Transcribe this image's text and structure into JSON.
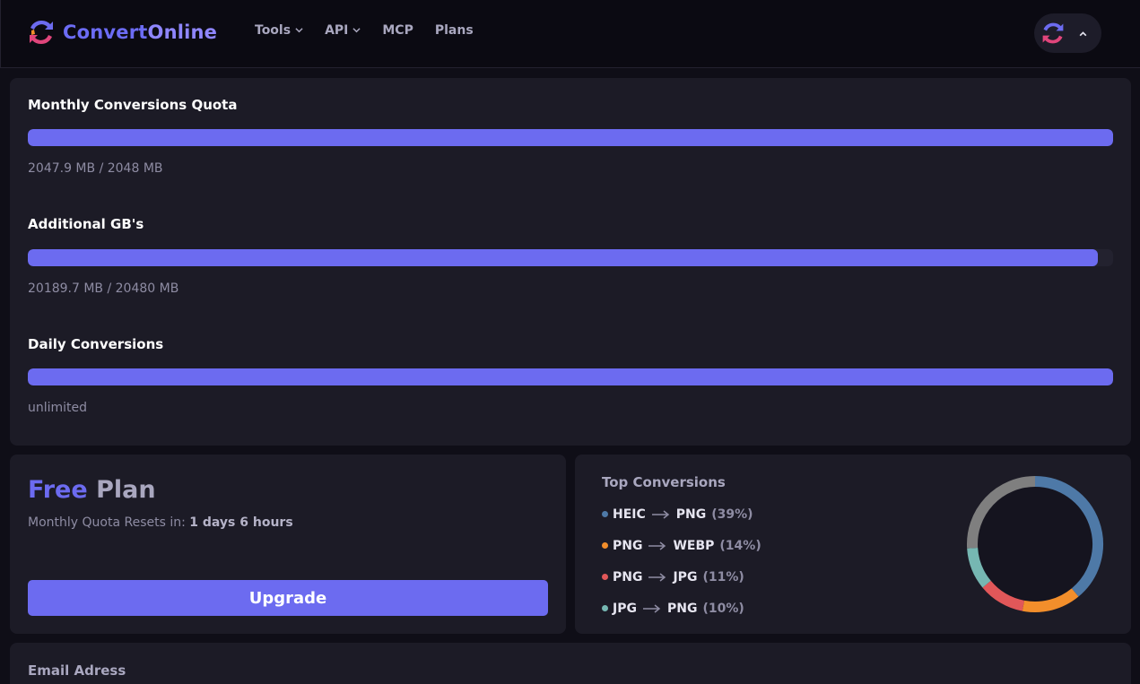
{
  "header": {
    "logo_part1": "Convert",
    "logo_part2": "Online",
    "nav": [
      {
        "label": "Tools",
        "has_dropdown": true
      },
      {
        "label": "API",
        "has_dropdown": true
      },
      {
        "label": "MCP",
        "has_dropdown": false
      },
      {
        "label": "Plans",
        "has_dropdown": false
      }
    ],
    "user_menu_icon": "chevron-up-icon"
  },
  "quota": {
    "items": [
      {
        "title": "Monthly Conversions Quota",
        "usage": "2047.9 MB / 2048 MB",
        "fill": 0.99995
      },
      {
        "title": "Additional GB's",
        "usage": "20189.7 MB / 20480 MB",
        "fill": 0.9858
      },
      {
        "title": "Daily Conversions",
        "usage": "unlimited",
        "fill": 1.0
      }
    ]
  },
  "plan": {
    "name": "Free",
    "word": "Plan",
    "reset_label": "Monthly Quota Resets in:",
    "reset_value": "1 days 6 hours",
    "upgrade_label": "Upgrade"
  },
  "top_conversions": {
    "title": "Top Conversions",
    "items": [
      {
        "from": "HEIC",
        "to": "PNG",
        "pct": "(39%)",
        "value": 39,
        "color": "#4e79a7"
      },
      {
        "from": "PNG",
        "to": "WEBP",
        "pct": "(14%)",
        "value": 14,
        "color": "#f28e2b"
      },
      {
        "from": "PNG",
        "to": "JPG",
        "pct": "(11%)",
        "value": 11,
        "color": "#e15759"
      },
      {
        "from": "JPG",
        "to": "PNG",
        "pct": "(10%)",
        "value": 10,
        "color": "#76b7b2"
      }
    ],
    "other": {
      "value": 26,
      "color": "#7f7f7f"
    }
  },
  "email": {
    "label": "Email Adress"
  },
  "colors": {
    "accent": "#6c6bf0",
    "background": "#0f0e17",
    "card": "#1c1b26"
  }
}
